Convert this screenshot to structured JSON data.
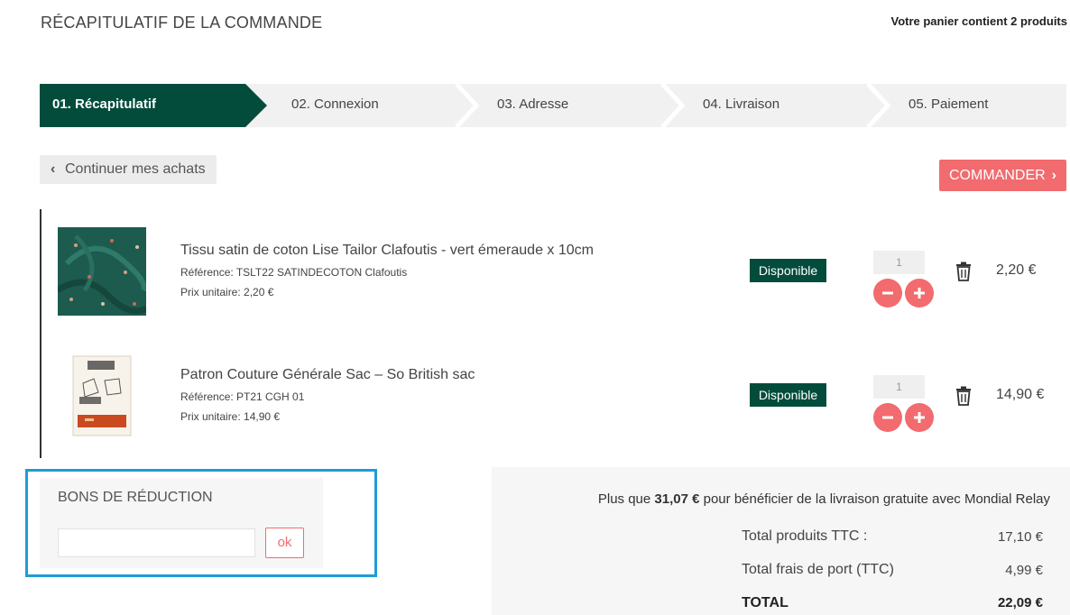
{
  "header": {
    "title": "RÉCAPITULATIF DE LA COMMANDE",
    "cart_count": "Votre panier contient 2 produits"
  },
  "steps": [
    {
      "label": "01. Récapitulatif",
      "active": true
    },
    {
      "label": "02. Connexion",
      "active": false
    },
    {
      "label": "03. Adresse",
      "active": false
    },
    {
      "label": "04. Livraison",
      "active": false
    },
    {
      "label": "05. Paiement",
      "active": false
    }
  ],
  "actions": {
    "continue_label": "Continuer mes achats",
    "order_label": "COMMANDER"
  },
  "products": [
    {
      "name": "Tissu satin de coton Lise Tailor Clafoutis - vert émeraude x 10cm",
      "reference": "Référence: TSLT22 SATINDECOTON Clafoutis",
      "unit_price": "Prix unitaire: 2,20 €",
      "availability": "Disponible",
      "quantity": "1",
      "price": "2,20 €",
      "image_icon": "green-fabric-thumbnail"
    },
    {
      "name": "Patron Couture Générale Sac – So British sac",
      "reference": "Référence: PT21 CGH 01",
      "unit_price": "Prix unitaire: 14,90 €",
      "availability": "Disponible",
      "quantity": "1",
      "price": "14,90 €",
      "image_icon": "sewing-pattern-thumbnail"
    }
  ],
  "vouchers": {
    "title": "BONS DE RÉDUCTION",
    "input_value": "",
    "ok_label": "ok"
  },
  "totals": {
    "free_shipping_prefix": "Plus que",
    "free_shipping_amount": "31,07 €",
    "free_shipping_suffix": "pour bénéficier de la livraison gratuite avec Mondial Relay",
    "products_label": "Total produits TTC :",
    "products_value": "17,10 €",
    "shipping_label": "Total frais de port (TTC)",
    "shipping_value": "4,99 €",
    "total_label": "TOTAL",
    "total_value": "22,09 €"
  },
  "colors": {
    "accent_green": "#034c3c",
    "accent_red": "#f26b6e",
    "highlight_blue": "#1f9bd7"
  }
}
